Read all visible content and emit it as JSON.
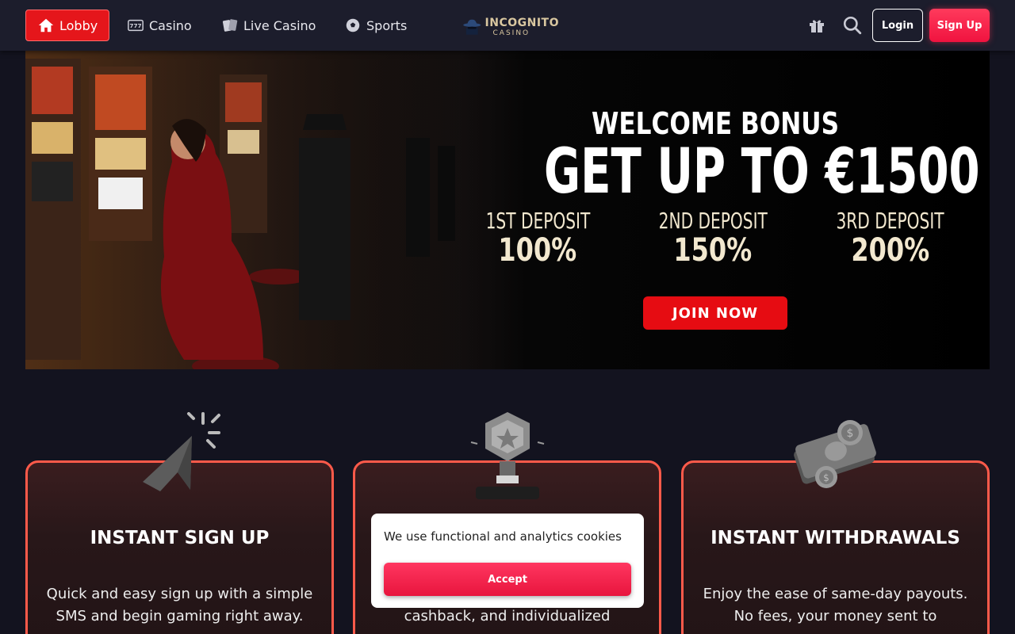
{
  "nav": {
    "lobby": "Lobby",
    "casino": "Casino",
    "live_casino": "Live Casino",
    "sports": "Sports"
  },
  "logo": {
    "main": "INCOGNITO",
    "sub": "CASINO"
  },
  "header": {
    "login": "Login",
    "signup": "Sign Up"
  },
  "banner": {
    "welcome": "WELCOME BONUS",
    "headline": "GET UP TO €1500",
    "deposits": [
      {
        "label": "1ST DEPOSIT",
        "value": "100%"
      },
      {
        "label": "2ND DEPOSIT",
        "value": "150%"
      },
      {
        "label": "3RD DEPOSIT",
        "value": "200%"
      }
    ],
    "cta": "JOIN NOW"
  },
  "cards": [
    {
      "title": "INSTANT SIGN UP",
      "desc": "Quick and easy sign up with a simple SMS and begin gaming right away.",
      "icon": "cursor-click-icon"
    },
    {
      "title": "",
      "desc": "cashback, and individualized",
      "icon": "trophy-icon"
    },
    {
      "title": "INSTANT WITHDRAWALS",
      "desc": "Enjoy the ease of same-day payouts. No fees, your money sent to",
      "icon": "money-icon"
    }
  ],
  "cookie": {
    "text": "We use functional and analytics cookies",
    "accept": "Accept"
  },
  "colors": {
    "accent": "#e5161b",
    "signup": "#f0133f",
    "card_border": "#ff5a4a",
    "header_bg": "#1c1d2c",
    "page_bg": "#13131f"
  }
}
